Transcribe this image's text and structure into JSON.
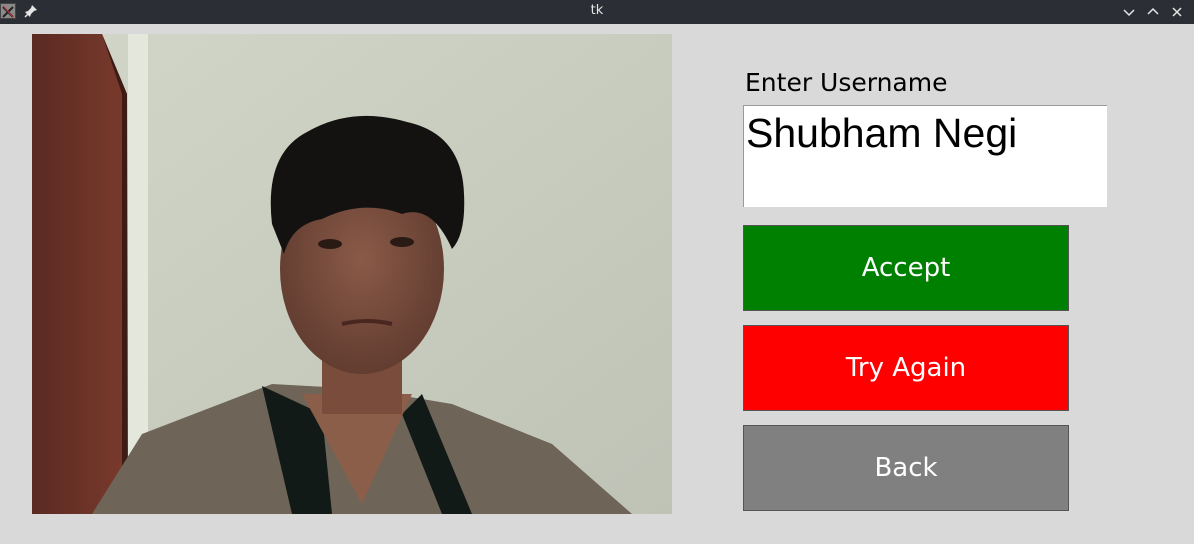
{
  "window": {
    "title": "tk",
    "app_icon": "x-app-icon",
    "pin_icon": "pin-icon",
    "controls": [
      "minimize-chevron-down-icon",
      "maximize-chevron-up-icon",
      "close-icon"
    ]
  },
  "camera": {
    "icon": "camera-feed-image"
  },
  "form": {
    "username_label": "Enter Username",
    "username_value": "Shubham Negi"
  },
  "buttons": {
    "accept": "Accept",
    "try_again": "Try Again",
    "back": "Back"
  },
  "colors": {
    "accept": "#008000",
    "try_again": "#ff0000",
    "back": "#808080",
    "background": "#d9d9d9",
    "titlebar": "#2b2e34"
  }
}
